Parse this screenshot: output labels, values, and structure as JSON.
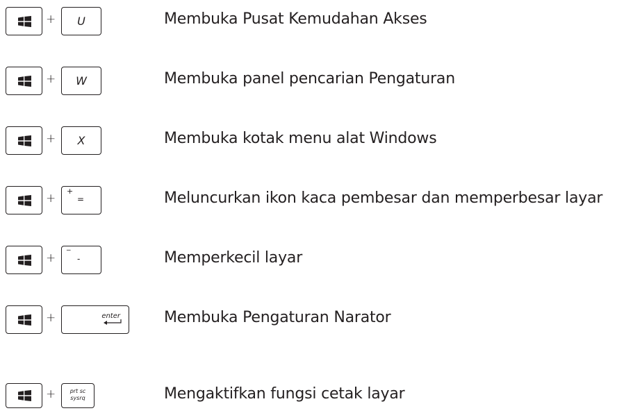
{
  "plus_sign": "+",
  "rows": [
    {
      "key": "U",
      "description": "Membuka Pusat Kemudahan Akses"
    },
    {
      "key": "W",
      "description": "Membuka panel pencarian Pengaturan"
    },
    {
      "key": "X",
      "description": "Membuka kotak menu alat Windows"
    },
    {
      "key_top": "+",
      "key_main": "=",
      "description": "Meluncurkan ikon kaca pembesar dan memperbesar layar"
    },
    {
      "key_top": "_",
      "key_main": "-",
      "description": "Memperkecil layar"
    },
    {
      "key": "enter",
      "description": "Membuka Pengaturan Narator"
    },
    {
      "key_top": "prt sc",
      "key_main": "sysrq",
      "description": "Mengaktifkan fungsi cetak layar"
    }
  ],
  "icons": {
    "windows_key": "windows-logo-icon",
    "enter_arrow": "enter-arrow-icon"
  }
}
